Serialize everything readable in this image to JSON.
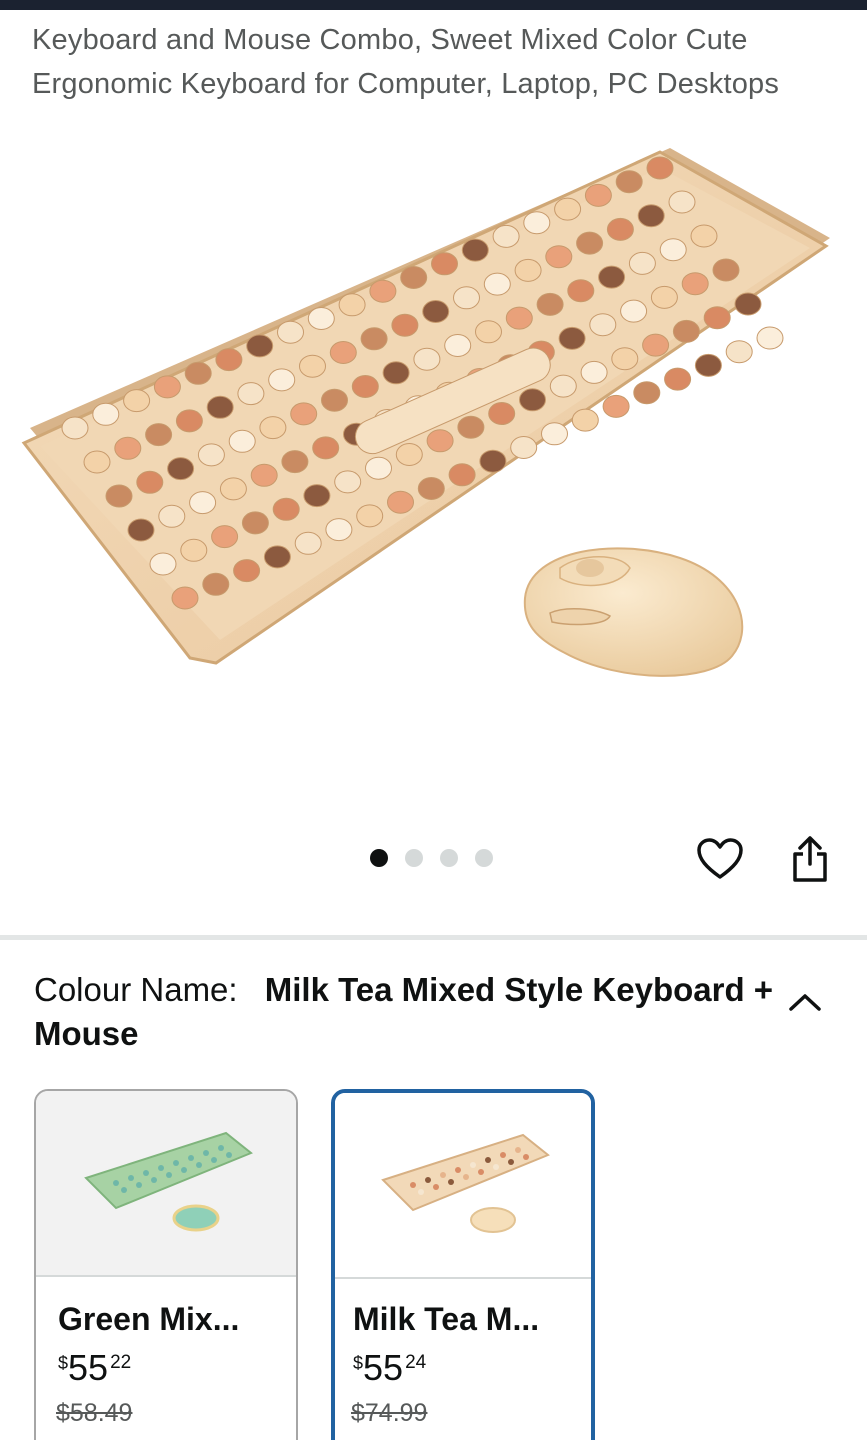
{
  "product": {
    "title": "Keyboard and Mouse Combo, Sweet Mixed Color Cute Ergonomic Keyboard for Computer, Laptop, PC Desktops"
  },
  "gallery": {
    "image_count": 4,
    "active_index": 0,
    "icons": {
      "favorite": "heart-icon",
      "share": "share-icon"
    }
  },
  "variation": {
    "label": "Colour Name:",
    "selected_value": "Milk Tea Mixed Style Keyboard + Mouse",
    "collapse_icon": "chevron-up-icon"
  },
  "swatches": [
    {
      "name": "Green Mix...",
      "currency": "$",
      "whole": "55",
      "fraction": "22",
      "was_price": "$58.49",
      "selected": false,
      "color": "#9fcf9f"
    },
    {
      "name": "Milk Tea M...",
      "currency": "$",
      "whole": "55",
      "fraction": "24",
      "was_price": "$74.99",
      "selected": true,
      "color": "#e9c9a5"
    }
  ],
  "colors": {
    "selected_border": "#2162a1",
    "text_primary": "#0f1111",
    "text_secondary": "#565959"
  }
}
